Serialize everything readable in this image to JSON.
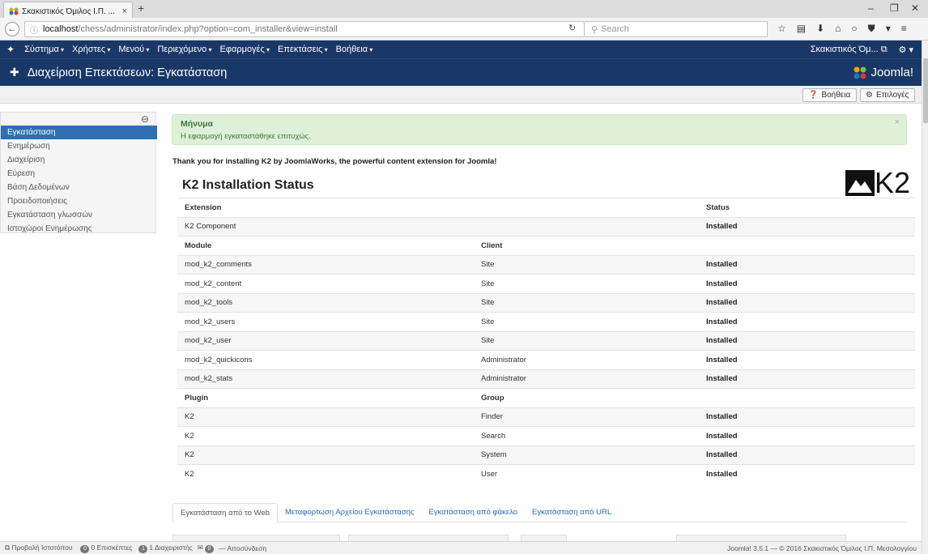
{
  "browser": {
    "tab_title": "Σκακιστικός Όμιλος Ι.Π. ...",
    "tab_close": "×",
    "new_tab": "+",
    "url_host": "localhost",
    "url_path": "/chess/administrator/index.php?option=com_installer&view=install",
    "search_placeholder": "Search"
  },
  "admin_menu": {
    "items": [
      "Σύστημα",
      "Χρήστες",
      "Μενού",
      "Περιεχόμενο",
      "Εφαρμογές",
      "Επεκτάσεις",
      "Βοήθεια"
    ],
    "site_name": "Σκακιστικός Όμ..."
  },
  "header": {
    "title": "Διαχείριση Επεκτάσεων: Εγκατάσταση",
    "brand": "Joomla!"
  },
  "toolbar": {
    "help_label": "Βοήθεια",
    "options_label": "Επιλογές"
  },
  "sidebar": {
    "items": [
      {
        "label": "Εγκατάσταση",
        "active": true
      },
      {
        "label": "Ενημέρωση"
      },
      {
        "label": "Διαχείριση"
      },
      {
        "label": "Εύρεση"
      },
      {
        "label": "Βάση Δεδομένων"
      },
      {
        "label": "Προειδοποιήσεις"
      },
      {
        "label": "Εγκατάσταση γλωσσών"
      },
      {
        "label": "Ιστοχώροι Ενημέρωσης"
      }
    ]
  },
  "alert": {
    "title": "Μήνυμα",
    "message": "Η εφαρμογή εγκαταστάθηκε επιτυχώς.",
    "close": "×"
  },
  "content": {
    "thanks": "Thank you for installing K2 by JoomlaWorks, the powerful content extension for Joomla!",
    "status_title": "K2 Installation Status",
    "logo_text": "K2"
  },
  "status_table": {
    "headers": {
      "extension": "Extension",
      "status": "Status",
      "module": "Module",
      "client": "Client",
      "plugin": "Plugin",
      "group": "Group"
    },
    "component": {
      "name": "K2 Component",
      "status": "Installed"
    },
    "modules": [
      {
        "name": "mod_k2_comments",
        "client": "Site",
        "status": "Installed"
      },
      {
        "name": "mod_k2_content",
        "client": "Site",
        "status": "Installed"
      },
      {
        "name": "mod_k2_tools",
        "client": "Site",
        "status": "Installed"
      },
      {
        "name": "mod_k2_users",
        "client": "Site",
        "status": "Installed"
      },
      {
        "name": "mod_k2_user",
        "client": "Site",
        "status": "Installed"
      },
      {
        "name": "mod_k2_quickicons",
        "client": "Administrator",
        "status": "Installed"
      },
      {
        "name": "mod_k2_stats",
        "client": "Administrator",
        "status": "Installed"
      }
    ],
    "plugins": [
      {
        "name": "K2",
        "group": "Finder",
        "status": "Installed"
      },
      {
        "name": "K2",
        "group": "Search",
        "status": "Installed"
      },
      {
        "name": "K2",
        "group": "System",
        "status": "Installed"
      },
      {
        "name": "K2",
        "group": "User",
        "status": "Installed"
      }
    ]
  },
  "install_tabs": [
    {
      "label": "Εγκατάσταση από το Web",
      "active": true
    },
    {
      "label": "Μεταφόρτωση Αρχείου Εγκατάστασης"
    },
    {
      "label": "Εγκατάσταση από φάκελο"
    },
    {
      "label": "Εγκατάσταση από URL"
    }
  ],
  "statusbar": {
    "preview_label": "Προβολή Ιστοτόπου",
    "visitors_count": "0",
    "visitors_label": "0 Επισκέπτες",
    "admins_count": "1",
    "admins_label": "1 Διαχειριστής",
    "messages_count": "0",
    "logout_label": "Αποσύνδεση",
    "footer": "Joomla! 3.5.1 — © 2016 Σκακιστικός Όμιλος Ι.Π. Μεσολογγίου"
  },
  "colors": {
    "header_bg": "#1a3867",
    "sidebar_active": "#2d6fb3",
    "alert_bg": "#dff0d8",
    "alert_text": "#3c763d",
    "link": "#2a69b8"
  }
}
